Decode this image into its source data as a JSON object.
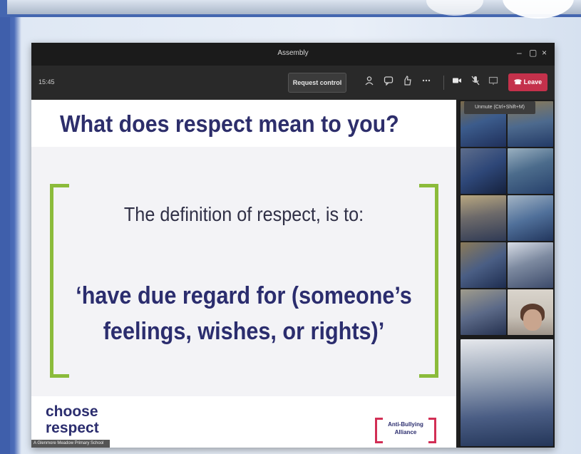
{
  "window": {
    "title": "Assembly"
  },
  "window_controls": [
    "–",
    "▢",
    "×"
  ],
  "toolbar": {
    "time": "15:45",
    "request_control_label": "Request control",
    "leave_label": "Leave",
    "icons": [
      "people-icon",
      "chat-icon",
      "reactions-icon",
      "more-icon",
      "camera-icon",
      "mic-icon",
      "share-icon"
    ],
    "tooltip": "Unmute (Ctrl+Shift+M)"
  },
  "slide": {
    "title": "What does respect mean to you?",
    "definition_intro": "The definition of respect, is to:",
    "definition_quote_line1": "‘have due regard for (someone’s",
    "definition_quote_line2": "feelings, wishes, or rights)’",
    "logo_line1": "choose",
    "logo_line2": "respect",
    "logo_subtitle": "A Glenmore Meadow Primary School",
    "partner_logo_line1": "Anti-Bullying",
    "partner_logo_line2": "Alliance"
  },
  "colors": {
    "accent_green": "#8bbb3b",
    "navy": "#2b2d6e",
    "leave_red": "#c4314b",
    "aba_pink": "#d22f55"
  },
  "participants": [
    {
      "name": "classroom-video-1",
      "active": false
    },
    {
      "name": "classroom-video-2",
      "active": false
    },
    {
      "name": "classroom-video-3",
      "active": false
    },
    {
      "name": "classroom-video-4",
      "active": false
    },
    {
      "name": "classroom-video-5",
      "active": false
    },
    {
      "name": "classroom-video-6",
      "active": false
    },
    {
      "name": "classroom-video-7",
      "active": false
    },
    {
      "name": "classroom-video-8",
      "active": false
    },
    {
      "name": "teacher-video",
      "active": true
    },
    {
      "name": "classroom-video-9",
      "active": false
    }
  ]
}
